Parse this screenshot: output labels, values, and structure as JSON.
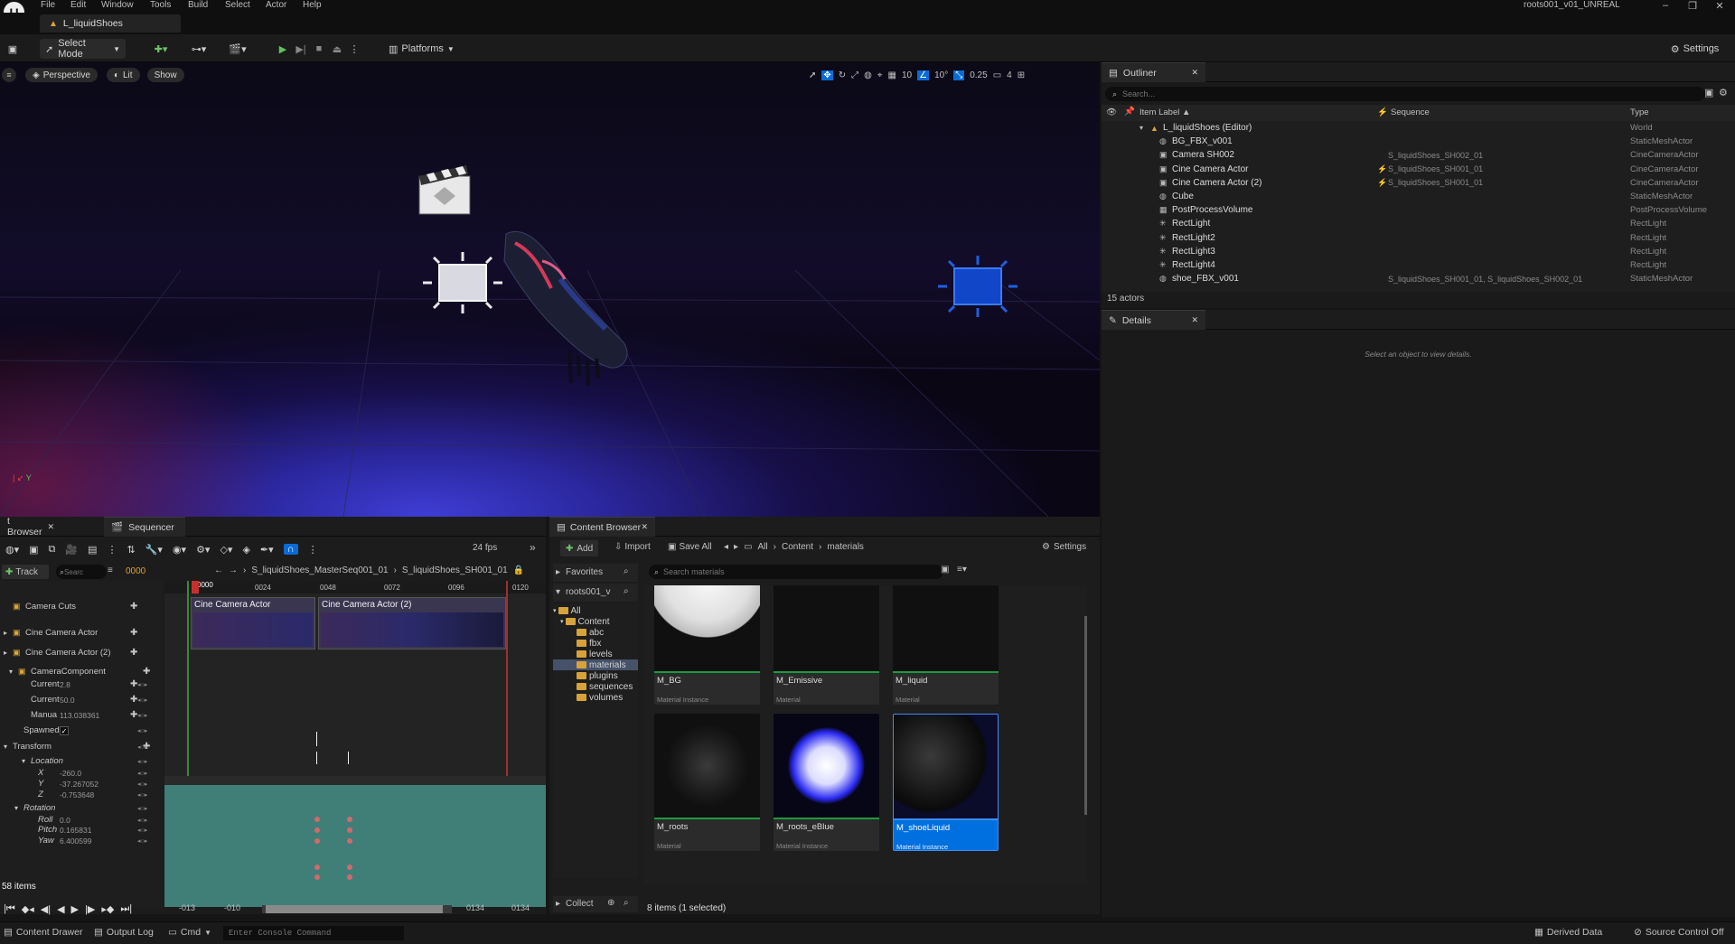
{
  "app": {
    "project_name": "roots001_v01_UNREAL",
    "level_tab": "L_liquidShoes",
    "logo": "unreal-logo"
  },
  "menu": [
    "File",
    "Edit",
    "Window",
    "Tools",
    "Build",
    "Select",
    "Actor",
    "Help"
  ],
  "toolbar": {
    "select_mode": "Select Mode",
    "platforms": "Platforms",
    "settings": "Settings"
  },
  "viewport": {
    "perspective": "Perspective",
    "lit": "Lit",
    "show": "Show",
    "grid_snap": "10",
    "rotation_snap": "10°",
    "scale_snap": "0.25",
    "camera_speed": "4",
    "axis_y": "Y"
  },
  "outliner": {
    "tab": "Outliner",
    "search_placeholder": "Search...",
    "col_label": "Item Label",
    "col_sequence": "Sequence",
    "col_type": "Type",
    "rows": [
      {
        "label": "L_liquidShoes (Editor)",
        "sequence": "",
        "type": "World"
      },
      {
        "label": "BG_FBX_v001",
        "sequence": "",
        "type": "StaticMeshActor"
      },
      {
        "label": "Camera SH002",
        "sequence": "S_liquidShoes_SH002_01",
        "type": "CineCameraActor"
      },
      {
        "label": "Cine Camera Actor",
        "sequence": "S_liquidShoes_SH001_01",
        "type": "CineCameraActor"
      },
      {
        "label": "Cine Camera Actor (2)",
        "sequence": "S_liquidShoes_SH001_01",
        "type": "CineCameraActor"
      },
      {
        "label": "Cube",
        "sequence": "",
        "type": "StaticMeshActor"
      },
      {
        "label": "PostProcessVolume",
        "sequence": "",
        "type": "PostProcessVolume"
      },
      {
        "label": "RectLight",
        "sequence": "",
        "type": "RectLight"
      },
      {
        "label": "RectLight2",
        "sequence": "",
        "type": "RectLight"
      },
      {
        "label": "RectLight3",
        "sequence": "",
        "type": "RectLight"
      },
      {
        "label": "RectLight4",
        "sequence": "",
        "type": "RectLight"
      },
      {
        "label": "shoe_FBX_v001",
        "sequence": "S_liquidShoes_SH001_01, S_liquidShoes_SH002_01",
        "type": "StaticMeshActor"
      }
    ],
    "actor_count": "15 actors"
  },
  "details": {
    "tab": "Details",
    "empty_text": "Select an object to view details."
  },
  "sequencer": {
    "tab_left": "t Browser",
    "tab": "Sequencer",
    "fps": "24 fps",
    "track_button": "Track",
    "search_placeholder": "Searc",
    "frame": "0000",
    "breadcrumb_master": "S_liquidShoes_MasterSeq001_01",
    "breadcrumb_shot": "S_liquidShoes_SH001_01",
    "ruler": [
      "0000",
      "0024",
      "0048",
      "0072",
      "0096",
      "0120"
    ],
    "clips": [
      "Cine Camera Actor",
      "Cine Camera Actor (2)"
    ],
    "tracks": [
      {
        "label": "Camera Cuts"
      },
      {
        "label": "Cine Camera Actor"
      },
      {
        "label": "Cine Camera Actor (2)"
      },
      {
        "label": "CameraComponent"
      },
      {
        "label": "Current",
        "value": "2.8"
      },
      {
        "label": "Current",
        "value": "50.0"
      },
      {
        "label": "Manua",
        "value": "113.038361"
      },
      {
        "label": "Spawned"
      },
      {
        "label": "Transform"
      },
      {
        "label": "Location"
      },
      {
        "label": "X",
        "value": "-260.0"
      },
      {
        "label": "Y",
        "value": "-37.267052"
      },
      {
        "label": "Z",
        "value": "-0.753648"
      },
      {
        "label": "Rotation"
      },
      {
        "label": "Roll",
        "value": "0.0"
      },
      {
        "label": "Pitch",
        "value": "0.165831"
      },
      {
        "label": "Yaw",
        "value": "6.400599"
      }
    ],
    "items_count": "58 items",
    "range_start": "-013",
    "range_start2": "-010",
    "range_end": "0134",
    "range_end2": "0134"
  },
  "content_browser": {
    "tab": "Content Browser",
    "add": "Add",
    "import": "Import",
    "save_all": "Save All",
    "path": [
      "All",
      "Content",
      "materials"
    ],
    "settings": "Settings",
    "favorites": "Favorites",
    "root": "roots001_v",
    "search_placeholder": "Search materials",
    "folders": [
      "All",
      "Content",
      "abc",
      "fbx",
      "levels",
      "materials",
      "plugins",
      "sequences",
      "volumes"
    ],
    "collections": "Collect",
    "assets": [
      {
        "name": "M_BG",
        "type": "Material Instance"
      },
      {
        "name": "M_Emissive",
        "type": "Material"
      },
      {
        "name": "M_liquid",
        "type": "Material"
      },
      {
        "name": "M_roots",
        "type": "Material"
      },
      {
        "name": "M_roots_eBlue",
        "type": "Material Instance"
      },
      {
        "name": "M_shoeLiquid",
        "type": "Material Instance"
      }
    ],
    "status": "8 items (1 selected)"
  },
  "statusbar": {
    "content_drawer": "Content Drawer",
    "output_log": "Output Log",
    "cmd": "Cmd",
    "console_placeholder": "Enter Console Command",
    "derived_data": "Derived Data",
    "source_control": "Source Control Off"
  },
  "colors": {
    "accent": "#0070e0",
    "selection": "#0a6bd6",
    "keyframe": "#d26a6a",
    "teal_track": "#3f7f78"
  }
}
